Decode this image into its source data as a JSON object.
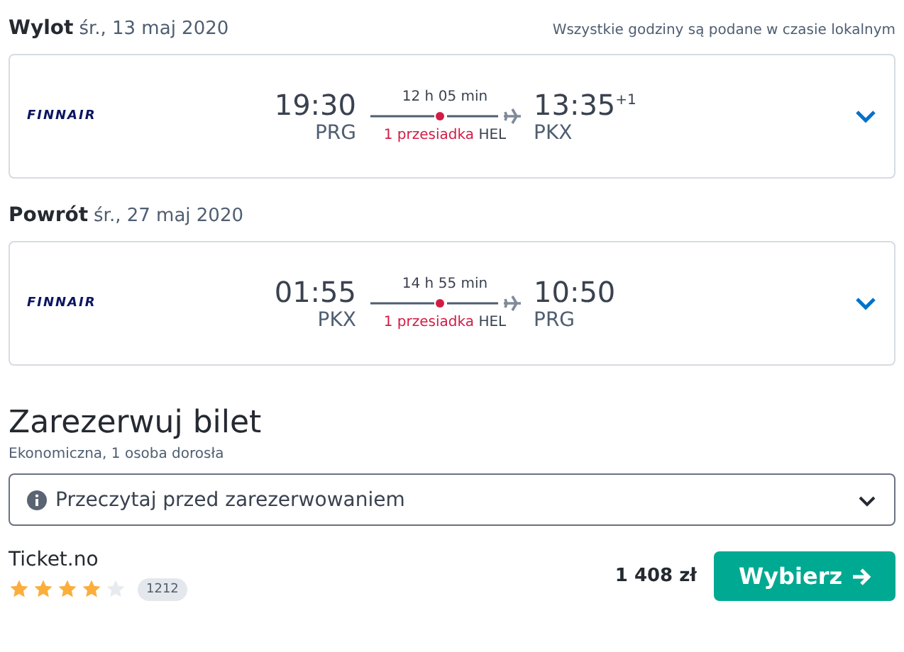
{
  "legs": [
    {
      "label": "Wylot",
      "date": "śr., 13 maj 2020",
      "note": "Wszystkie godziny są podane w czasie lokalnym",
      "airline": "FINNAIR",
      "dep_time": "19:30",
      "dep_airport": "PRG",
      "duration": "12 h 05 min",
      "stops": "1 przesiadka",
      "stop_airport": "HEL",
      "arr_time": "13:35",
      "arr_offset": "+1",
      "arr_airport": "PKX",
      "expanded": false
    },
    {
      "label": "Powrót",
      "date": "śr., 27 maj 2020",
      "airline": "FINNAIR",
      "dep_time": "01:55",
      "dep_airport": "PKX",
      "duration": "14 h 55 min",
      "stops": "1 przesiadka",
      "stop_airport": "HEL",
      "arr_time": "10:50",
      "arr_airport": "PRG",
      "expanded": false
    }
  ],
  "booking": {
    "title": "Zarezerwuj bilet",
    "subtitle": "Ekonomiczna, 1 osoba dorosła",
    "info": "Przeczytaj przed zarezerwowaniem",
    "info_expanded": false,
    "provider": "Ticket.no",
    "stars": 4,
    "reviews": "1212",
    "price": "1 408 zł",
    "button": "Wybierz"
  }
}
